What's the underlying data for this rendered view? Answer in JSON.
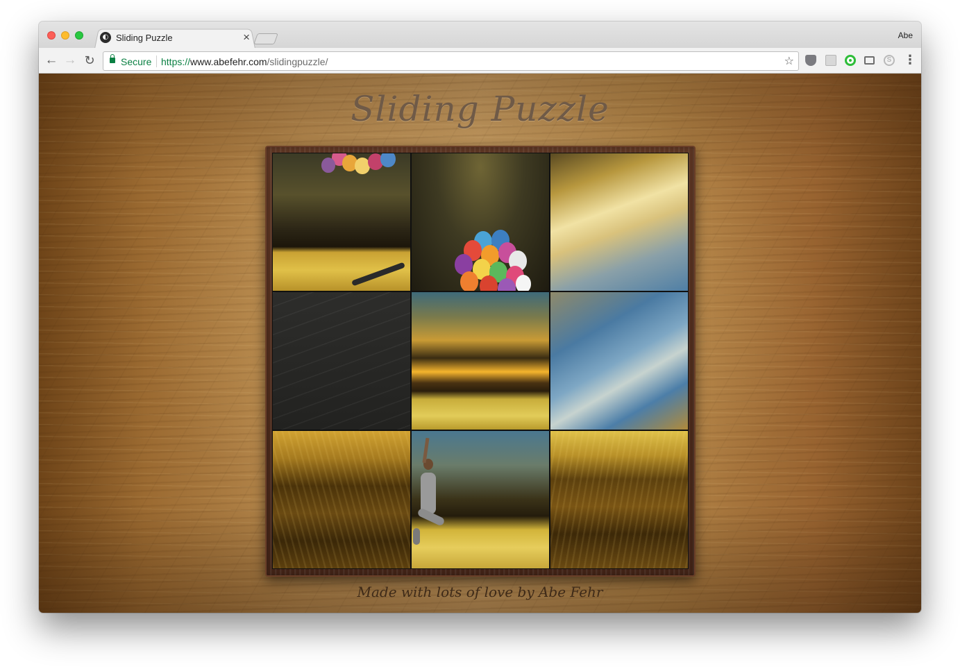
{
  "browser": {
    "tab_title": "Sliding Puzzle",
    "tab_close_glyph": "×",
    "favicon_glyph": "◐",
    "profile_name": "Abe",
    "secure_label": "Secure",
    "url_scheme": "https://",
    "url_host": "www.abefehr.com",
    "url_path": "/slidingpuzzle/",
    "icons": [
      "back-icon",
      "forward-icon",
      "reload-icon",
      "lock-icon",
      "bookmark-star-icon",
      "shield-extension-icon",
      "doc-extension-icon",
      "green-extension-icon",
      "cast-icon",
      "skype-extension-icon",
      "menu-icon"
    ]
  },
  "page": {
    "title": "Sliding Puzzle",
    "footer": "Made with lots of love by Abe Fehr"
  },
  "puzzle": {
    "grid_size": 3,
    "tiles": [
      {
        "id": "tile-1",
        "content": "balloons-top-and-legs"
      },
      {
        "id": "tile-2",
        "content": "balloon-cluster"
      },
      {
        "id": "tile-3",
        "content": "bright-sky"
      },
      {
        "id": "tile-4",
        "content": "empty-slot"
      },
      {
        "id": "tile-5",
        "content": "sunset-horizon"
      },
      {
        "id": "tile-6",
        "content": "blue-sky-clouds"
      },
      {
        "id": "tile-7",
        "content": "wheat-field-left"
      },
      {
        "id": "tile-8",
        "content": "jumping-person"
      },
      {
        "id": "tile-9",
        "content": "wheat-field-right"
      }
    ]
  },
  "colors": {
    "secure_green": "#0b8043",
    "wood_mid": "#c69b60",
    "frame_brown": "#5a3422",
    "title_color": "#6f5a47"
  }
}
